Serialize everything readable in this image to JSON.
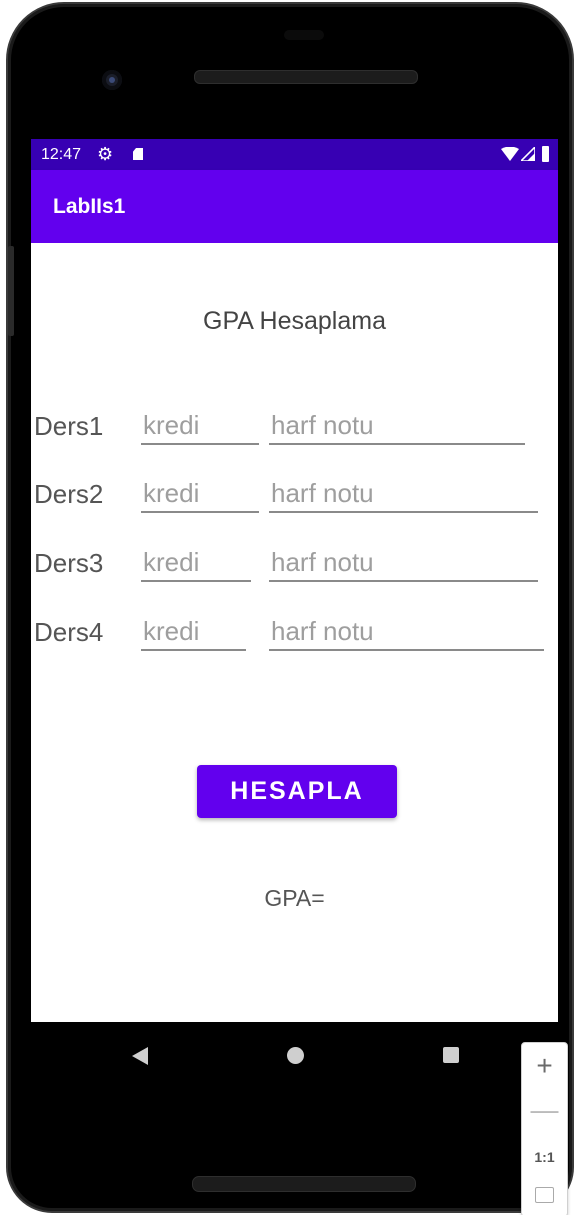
{
  "status_bar": {
    "time": "12:47",
    "icons": [
      "gear-icon",
      "sd-card-icon",
      "wifi-icon",
      "signal-icon",
      "battery-icon"
    ]
  },
  "app_bar": {
    "title": "LabIIs1"
  },
  "main": {
    "heading": "GPA Hesaplama",
    "rows": [
      {
        "label": "Ders1",
        "credit_placeholder": "kredi",
        "grade_placeholder": "harf notu"
      },
      {
        "label": "Ders2",
        "credit_placeholder": "kredi",
        "grade_placeholder": "harf notu"
      },
      {
        "label": "Ders3",
        "credit_placeholder": "kredi",
        "grade_placeholder": "harf notu"
      },
      {
        "label": "Ders4",
        "credit_placeholder": "kredi",
        "grade_placeholder": "harf notu"
      }
    ],
    "calculate_button": "HESAPLA",
    "result_label": "GPA="
  },
  "nav_bar": {
    "buttons": [
      "back-icon",
      "home-icon",
      "recent-apps-icon"
    ]
  },
  "zoom_panel": {
    "zoom_in": "+",
    "zoom_out": "—",
    "actual_size": "1:1"
  },
  "colors": {
    "status_bar": "#3700b3",
    "primary": "#6200ee",
    "on_primary": "#ffffff"
  }
}
